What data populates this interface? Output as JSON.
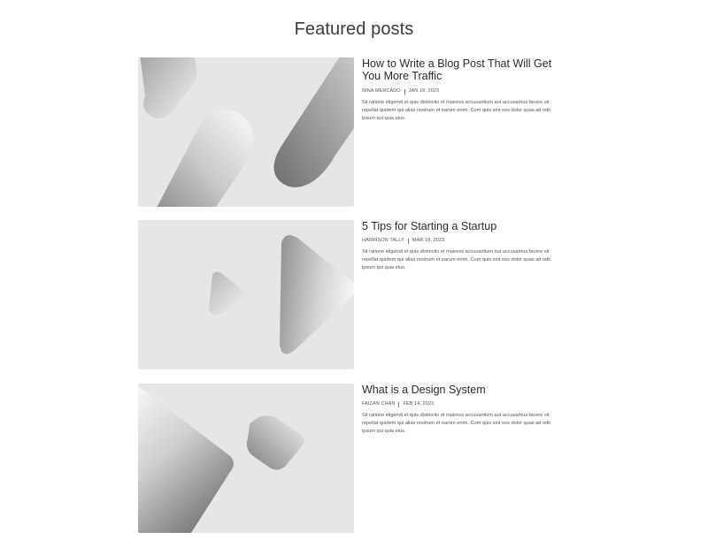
{
  "section": {
    "title": "Featured posts"
  },
  "posts": [
    {
      "title": "How to Write a Blog Post That Will Get You More Traffic",
      "author": "NINA MERCADO",
      "date": "JAN 18, 2023",
      "excerpt": "Sit ratione eligendi et quis distinctio et maiores accusantium aut accusamus facere sit repellat quidem qui alias nostrum et earum enim. Cum quis sint eos dolor quas ad odit ipsum qui quia eius."
    },
    {
      "title": "5 Tips for Starting a Startup",
      "author": "HARRISON TALLY",
      "date": "MAR 18, 2023",
      "excerpt": "Sit ratione eligendi et quis distinctio et maiores accusantium aut accusamus facere sit repellat quidem qui alias nostrum et earum enim. Cum quis sint eos dolor quas ad odit ipsum qui quia eius."
    },
    {
      "title": "What is a Design System",
      "author": "FAIZAN CHAN",
      "date": "FEB 14, 2023",
      "excerpt": "Sit ratione eligendi et quis distinctio et maiores accusantium aut accusamus facere sit repellat quidem qui alias nostrum et earum enim. Cum quis sint eos dolor quas ad odit ipsum qui quia eius."
    }
  ],
  "colors": {
    "thumb_background": "#e6e6e8",
    "shape_light": "#f7f7f7",
    "shape_dark": "#7c7c7c"
  }
}
